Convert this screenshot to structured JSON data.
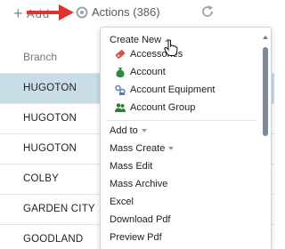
{
  "toolbar": {
    "add_label": "Add",
    "actions_label": "Actions (386)"
  },
  "table": {
    "column_header": "Branch",
    "rows": [
      {
        "branch": "HUGOTON",
        "selected": true
      },
      {
        "branch": "HUGOTON",
        "selected": false
      },
      {
        "branch": "HUGOTON",
        "selected": false
      },
      {
        "branch": "COLBY",
        "selected": false
      },
      {
        "branch": "GARDEN CITY",
        "selected": false
      },
      {
        "branch": "GOODLAND",
        "selected": false
      }
    ]
  },
  "dropdown": {
    "create_new": "Create New",
    "create_new_items": [
      {
        "label": "Accessories",
        "icon": "tag-icon",
        "color": "#d9534f"
      },
      {
        "label": "Account",
        "icon": "money-bag-icon",
        "color": "#2e8b3d"
      },
      {
        "label": "Account Equipment",
        "icon": "equipment-icon",
        "color": "#5b7da6"
      },
      {
        "label": "Account Group",
        "icon": "people-group-icon",
        "color": "#2e7d32"
      }
    ],
    "items": [
      {
        "label": "Add to",
        "caret": "down"
      },
      {
        "label": "Mass Create",
        "caret": "down"
      },
      {
        "label": "Mass Edit"
      },
      {
        "label": "Mass Archive"
      },
      {
        "label": "Excel"
      },
      {
        "label": "Download Pdf"
      },
      {
        "label": "Preview Pdf"
      }
    ]
  },
  "colors": {
    "selected_row": "#c9dde6",
    "annotation_arrow": "#e0322b",
    "scroll_thumb": "#7a8a99"
  }
}
